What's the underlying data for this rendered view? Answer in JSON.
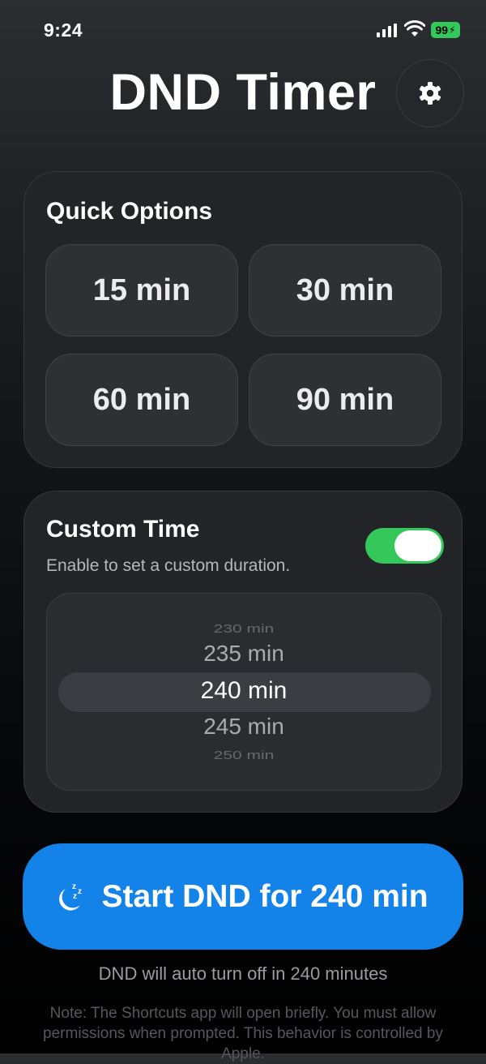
{
  "status_bar": {
    "time": "9:24",
    "battery": "99"
  },
  "header": {
    "title": "DND Timer",
    "settings_icon": "gear-icon"
  },
  "quick_options": {
    "title": "Quick Options",
    "options": [
      {
        "label": "15 min"
      },
      {
        "label": "30 min"
      },
      {
        "label": "60 min"
      },
      {
        "label": "90 min"
      }
    ]
  },
  "custom_time": {
    "title": "Custom Time",
    "subtitle": "Enable to set a custom duration.",
    "toggle_on": true,
    "picker_values": [
      "230 min",
      "235 min",
      "240 min",
      "245 min",
      "250 min"
    ],
    "selected": "240 min"
  },
  "start_button": {
    "label": "Start DND for 240 min",
    "icon": "moon-zzz-icon"
  },
  "auto_off_text": "DND will auto turn off in 240 minutes",
  "note": "Note: The Shortcuts app will open briefly. You must allow permissions when prompted. This behavior is controlled by Apple.",
  "colors": {
    "accent_blue": "#1382e9",
    "toggle_green": "#34c759",
    "card_bg": "#222427"
  }
}
